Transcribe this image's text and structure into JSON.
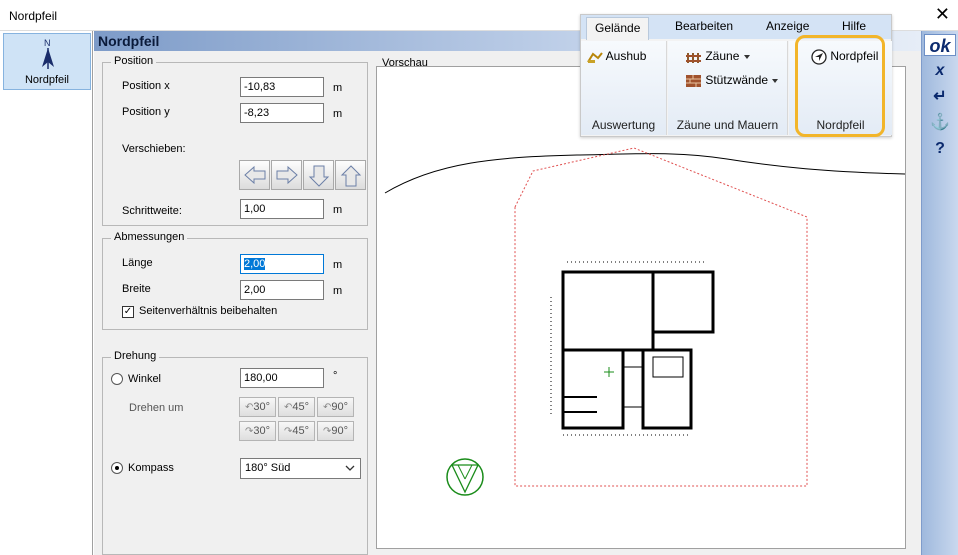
{
  "window": {
    "title": "Nordpfeil",
    "close": "✕"
  },
  "left": {
    "item_label": "Nordpfeil",
    "icon_letter": "N"
  },
  "header": {
    "title": "Nordpfeil"
  },
  "position": {
    "group": "Position",
    "x_label": "Position x",
    "x_value": "-10,83",
    "x_unit": "m",
    "y_label": "Position y",
    "y_value": "-8,23",
    "y_unit": "m",
    "move_label": "Verschieben:",
    "step_label": "Schrittweite:",
    "step_value": "1,00",
    "step_unit": "m"
  },
  "dimensions": {
    "group": "Abmessungen",
    "length_label": "Länge",
    "length_value": "2,00",
    "length_unit": "m",
    "width_label": "Breite",
    "width_value": "2,00",
    "width_unit": "m",
    "keep_ratio_label": "Seitenverhältnis beibehalten",
    "keep_ratio_mark": "✓"
  },
  "rotation": {
    "group": "Drehung",
    "angle_label": "Winkel",
    "angle_value": "180,00",
    "angle_unit": "°",
    "rotate_by_label": "Drehen um",
    "ccw": [
      "30°",
      "45°",
      "90°"
    ],
    "cw": [
      "30°",
      "45°",
      "90°"
    ],
    "compass_label": "Kompass",
    "compass_value": "180° Süd"
  },
  "preview": {
    "label": "Vorschau"
  },
  "ribbon": {
    "tabs": [
      "Gelände",
      "Bearbeiten",
      "Anzeige",
      "Hilfe"
    ],
    "aushub": "Aushub",
    "auswertung": "Auswertung",
    "zaeune": "Zäune",
    "stuetzwaende": "Stützwände",
    "zaeune_mauern": "Zäune und Mauern",
    "nordpfeil_btn": "Nordpfeil",
    "nordpfeil_cap": "Nordpfeil"
  },
  "rightbar": {
    "ok": "ok",
    "cancel": "x",
    "enter": "↵",
    "anchor": "⚓",
    "help": "?"
  },
  "colors": {
    "highlight": "#f2b52a",
    "accent": "#0078d7"
  }
}
